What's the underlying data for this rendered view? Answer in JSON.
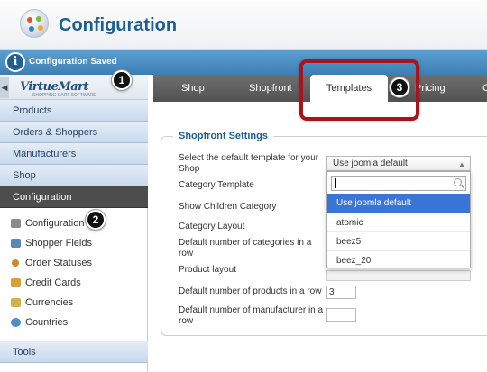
{
  "header": {
    "title": "Configuration"
  },
  "message": {
    "text": "Configuration Saved"
  },
  "sidebar": {
    "brand": "VirtueMart",
    "tagline": "SHOPPING CART SOFTWARE",
    "collapse_glyph": "◀",
    "menu": [
      {
        "label": "Products"
      },
      {
        "label": "Orders & Shoppers"
      },
      {
        "label": "Manufacturers"
      },
      {
        "label": "Shop"
      },
      {
        "label": "Configuration",
        "active": true
      }
    ],
    "submenu": [
      {
        "label": "Configuration",
        "icon": "wrench-icon",
        "color": "#8a8a8a"
      },
      {
        "label": "Shopper Fields",
        "icon": "fields-icon",
        "color": "#5b86b8"
      },
      {
        "label": "Order Statuses",
        "icon": "gear-dots-icon",
        "color": "#c98b2e"
      },
      {
        "label": "Credit Cards",
        "icon": "credit-card-icon",
        "color": "#d6a13a"
      },
      {
        "label": "Currencies",
        "icon": "coins-icon",
        "color": "#d1b24a"
      },
      {
        "label": "Countries",
        "icon": "globe-icon",
        "color": "#4f8fc9"
      }
    ],
    "tools": {
      "label": "Tools"
    }
  },
  "tabs": [
    {
      "label": "Shop"
    },
    {
      "label": "Shopfront"
    },
    {
      "label": "Templates",
      "active": true
    },
    {
      "label": "Pricing"
    },
    {
      "label": "C"
    }
  ],
  "form": {
    "legend": "Shopfront Settings",
    "labels": {
      "default_template": "Select the default template for your Shop",
      "category_template": "Category Template",
      "show_children": "Show Children Category",
      "category_layout": "Category Layout",
      "categories_per_row": "Default number of categories in a row",
      "product_layout": "Product layout",
      "products_per_row": "Default number of products in a row",
      "manufacturers_per_row": "Default number of manufacturer in a row"
    },
    "select_value": "Use joomla default",
    "products_per_row_value": "3",
    "manufacturers_per_row_value": "",
    "dropdown_options": [
      "Use joomla default",
      "atomic",
      "beez5",
      "beez_20"
    ]
  },
  "callouts": [
    "1",
    "2",
    "3"
  ],
  "colors": {
    "accent": "#1b5e93",
    "highlight": "#a8141b",
    "selected": "#3875d7"
  }
}
